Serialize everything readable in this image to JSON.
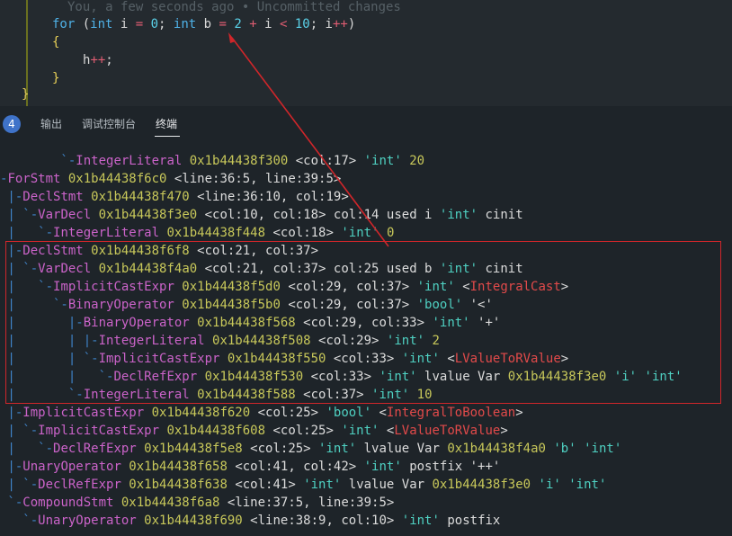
{
  "editor": {
    "blame": "You, a few seconds ago • Uncommitted changes",
    "for_kw": "for",
    "for_rest_1": " (",
    "int_kw": "int",
    "for_rest_2": " i ",
    "eq": "=",
    "zero": " 0",
    "semi1": "; ",
    "int_kw2": "int",
    "for_rest_3": " b ",
    "eq2": "=",
    "two": " 2",
    "plus": " + ",
    "i_lt": "i ",
    "lt": "<",
    "ten": " 10",
    "semi2": "; i",
    "pp": "++",
    "paren_close": ")",
    "open_brace": "{",
    "body_var": "h",
    "body_pp": "++",
    "body_semi": ";",
    "close_brace": "}",
    "outer_brace": "}"
  },
  "panel": {
    "badge": "4",
    "tabs": [
      "输出",
      "调试控制台",
      "终端"
    ],
    "active_tab": "终端"
  },
  "terminal": {
    "lines": [
      [
        [
          "tree",
          "        `-"
        ],
        [
          "node",
          "IntegerLiteral"
        ],
        [
          "addr",
          " 0x1b44438f300"
        ],
        [
          "plain",
          " <col:17> "
        ],
        [
          "str",
          "'int'"
        ],
        [
          "plain",
          " "
        ],
        [
          "addr",
          "20"
        ]
      ],
      [
        [
          "tree",
          "-"
        ],
        [
          "node",
          "ForStmt"
        ],
        [
          "addr",
          " 0x1b44438f6c0"
        ],
        [
          "plain",
          " <line:36:5, line:39:5>"
        ]
      ],
      [
        [
          "tree",
          " |-"
        ],
        [
          "node",
          "DeclStmt"
        ],
        [
          "addr",
          " 0x1b44438f470"
        ],
        [
          "plain",
          " <line:36:10, col:19>"
        ]
      ],
      [
        [
          "tree",
          " | `-"
        ],
        [
          "node",
          "VarDecl"
        ],
        [
          "addr",
          " 0x1b44438f3e0"
        ],
        [
          "plain",
          " <col:10, col:18> col:14 used i "
        ],
        [
          "str",
          "'int'"
        ],
        [
          "plain",
          " cinit"
        ]
      ],
      [
        [
          "tree",
          " |   `-"
        ],
        [
          "node",
          "IntegerLiteral"
        ],
        [
          "addr",
          " 0x1b44438f448"
        ],
        [
          "plain",
          " <col:18> "
        ],
        [
          "str",
          "'int'"
        ],
        [
          "plain",
          " "
        ],
        [
          "addr",
          "0"
        ]
      ],
      [
        [
          "tree",
          " |-"
        ],
        [
          "node",
          "DeclStmt"
        ],
        [
          "addr",
          " 0x1b44438f6f8"
        ],
        [
          "plain",
          " <col:21, col:37>"
        ]
      ],
      [
        [
          "tree",
          " | `-"
        ],
        [
          "node",
          "VarDecl"
        ],
        [
          "addr",
          " 0x1b44438f4a0"
        ],
        [
          "plain",
          " <col:21, col:37> col:25 used b "
        ],
        [
          "str",
          "'int'"
        ],
        [
          "plain",
          " cinit"
        ]
      ],
      [
        [
          "tree",
          " |   `-"
        ],
        [
          "node",
          "ImplicitCastExpr"
        ],
        [
          "addr",
          " 0x1b44438f5d0"
        ],
        [
          "plain",
          " <col:29, col:37> "
        ],
        [
          "str",
          "'int'"
        ],
        [
          "plain",
          " <"
        ],
        [
          "cast",
          "IntegralCast"
        ],
        [
          "plain",
          ">"
        ]
      ],
      [
        [
          "tree",
          " |     `-"
        ],
        [
          "node",
          "BinaryOperator"
        ],
        [
          "addr",
          " 0x1b44438f5b0"
        ],
        [
          "plain",
          " <col:29, col:37> "
        ],
        [
          "str",
          "'bool'"
        ],
        [
          "plain",
          " '<'"
        ]
      ],
      [
        [
          "tree",
          " |       |-"
        ],
        [
          "node",
          "BinaryOperator"
        ],
        [
          "addr",
          " 0x1b44438f568"
        ],
        [
          "plain",
          " <col:29, col:33> "
        ],
        [
          "str",
          "'int'"
        ],
        [
          "plain",
          " '+'"
        ]
      ],
      [
        [
          "tree",
          " |       | |-"
        ],
        [
          "node",
          "IntegerLiteral"
        ],
        [
          "addr",
          " 0x1b44438f508"
        ],
        [
          "plain",
          " <col:29> "
        ],
        [
          "str",
          "'int'"
        ],
        [
          "plain",
          " "
        ],
        [
          "addr",
          "2"
        ]
      ],
      [
        [
          "tree",
          " |       | `-"
        ],
        [
          "node",
          "ImplicitCastExpr"
        ],
        [
          "addr",
          " 0x1b44438f550"
        ],
        [
          "plain",
          " <col:33> "
        ],
        [
          "str",
          "'int'"
        ],
        [
          "plain",
          " <"
        ],
        [
          "cast",
          "LValueToRValue"
        ],
        [
          "plain",
          ">"
        ]
      ],
      [
        [
          "tree",
          " |       |   `-"
        ],
        [
          "node",
          "DeclRefExpr"
        ],
        [
          "addr",
          " 0x1b44438f530"
        ],
        [
          "plain",
          " <col:33> "
        ],
        [
          "str",
          "'int'"
        ],
        [
          "plain",
          " lvalue Var "
        ],
        [
          "addr",
          "0x1b44438f3e0"
        ],
        [
          "plain",
          " "
        ],
        [
          "str",
          "'i'"
        ],
        [
          "plain",
          " "
        ],
        [
          "str",
          "'int'"
        ]
      ],
      [
        [
          "tree",
          " |       `-"
        ],
        [
          "node",
          "IntegerLiteral"
        ],
        [
          "addr",
          " 0x1b44438f588"
        ],
        [
          "plain",
          " <col:37> "
        ],
        [
          "str",
          "'int'"
        ],
        [
          "plain",
          " "
        ],
        [
          "addr",
          "10"
        ]
      ],
      [
        [
          "tree",
          " |-"
        ],
        [
          "node",
          "ImplicitCastExpr"
        ],
        [
          "addr",
          " 0x1b44438f620"
        ],
        [
          "plain",
          " <col:25> "
        ],
        [
          "str",
          "'bool'"
        ],
        [
          "plain",
          " <"
        ],
        [
          "cast",
          "IntegralToBoolean"
        ],
        [
          "plain",
          ">"
        ]
      ],
      [
        [
          "tree",
          " | `-"
        ],
        [
          "node",
          "ImplicitCastExpr"
        ],
        [
          "addr",
          " 0x1b44438f608"
        ],
        [
          "plain",
          " <col:25> "
        ],
        [
          "str",
          "'int'"
        ],
        [
          "plain",
          " <"
        ],
        [
          "cast",
          "LValueToRValue"
        ],
        [
          "plain",
          ">"
        ]
      ],
      [
        [
          "tree",
          " |   `-"
        ],
        [
          "node",
          "DeclRefExpr"
        ],
        [
          "addr",
          " 0x1b44438f5e8"
        ],
        [
          "plain",
          " <col:25> "
        ],
        [
          "str",
          "'int'"
        ],
        [
          "plain",
          " lvalue Var "
        ],
        [
          "addr",
          "0x1b44438f4a0"
        ],
        [
          "plain",
          " "
        ],
        [
          "str",
          "'b'"
        ],
        [
          "plain",
          " "
        ],
        [
          "str",
          "'int'"
        ]
      ],
      [
        [
          "tree",
          " |-"
        ],
        [
          "node",
          "UnaryOperator"
        ],
        [
          "addr",
          " 0x1b44438f658"
        ],
        [
          "plain",
          " <col:41, col:42> "
        ],
        [
          "str",
          "'int'"
        ],
        [
          "plain",
          " postfix '++'"
        ]
      ],
      [
        [
          "tree",
          " | `-"
        ],
        [
          "node",
          "DeclRefExpr"
        ],
        [
          "addr",
          " 0x1b44438f638"
        ],
        [
          "plain",
          " <col:41> "
        ],
        [
          "str",
          "'int'"
        ],
        [
          "plain",
          " lvalue Var "
        ],
        [
          "addr",
          "0x1b44438f3e0"
        ],
        [
          "plain",
          " "
        ],
        [
          "str",
          "'i'"
        ],
        [
          "plain",
          " "
        ],
        [
          "str",
          "'int'"
        ]
      ],
      [
        [
          "tree",
          " `-"
        ],
        [
          "node",
          "CompoundStmt"
        ],
        [
          "addr",
          " 0x1b44438f6a8"
        ],
        [
          "plain",
          " <line:37:5, line:39:5>"
        ]
      ],
      [
        [
          "tree",
          "   `-"
        ],
        [
          "node",
          "UnaryOperator"
        ],
        [
          "addr",
          " 0x1b44438f690"
        ],
        [
          "plain",
          " <line:38:9, col:10> "
        ],
        [
          "str",
          "'int'"
        ],
        [
          "plain",
          " postfix"
        ]
      ]
    ]
  },
  "colors": {
    "highlight_border": "#d0262a",
    "arrow": "#d0262a"
  }
}
